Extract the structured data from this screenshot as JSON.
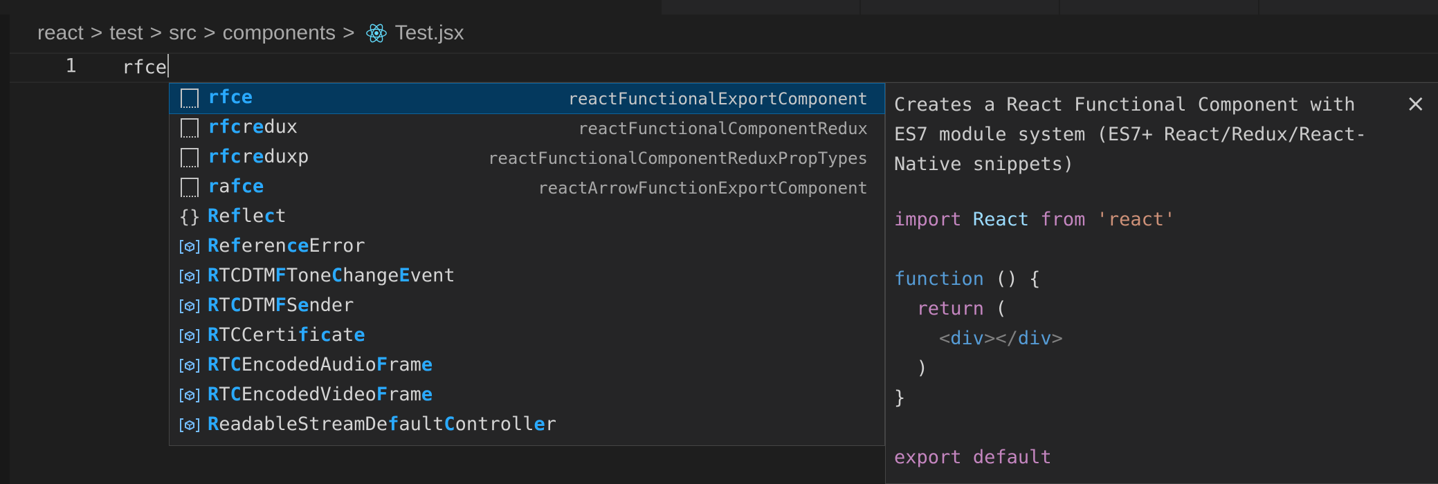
{
  "breadcrumb": {
    "items": [
      "react",
      "test",
      "src",
      "components"
    ],
    "file": "Test.jsx",
    "separator": ">"
  },
  "editor": {
    "line_number": "1",
    "content": "rfce"
  },
  "suggestions": [
    {
      "icon": "snippet-icon",
      "parts": [
        {
          "t": "rfce",
          "m": true
        }
      ],
      "detail": "reactFunctionalExportComponent",
      "selected": true
    },
    {
      "icon": "snippet-icon",
      "parts": [
        {
          "t": "rfc",
          "m": true
        },
        {
          "t": "r",
          "m": false
        },
        {
          "t": "e",
          "m": true
        },
        {
          "t": "dux",
          "m": false
        }
      ],
      "detail": "reactFunctionalComponentRedux"
    },
    {
      "icon": "snippet-icon",
      "parts": [
        {
          "t": "rfc",
          "m": true
        },
        {
          "t": "r",
          "m": false
        },
        {
          "t": "e",
          "m": true
        },
        {
          "t": "duxp",
          "m": false
        }
      ],
      "detail": "reactFunctionalComponentReduxPropTypes"
    },
    {
      "icon": "snippet-icon",
      "parts": [
        {
          "t": "r",
          "m": true
        },
        {
          "t": "a",
          "m": false
        },
        {
          "t": "fce",
          "m": true
        }
      ],
      "detail": "reactArrowFunctionExportComponent"
    },
    {
      "icon": "module-icon",
      "parts": [
        {
          "t": "R",
          "m": true
        },
        {
          "t": "e",
          "m": false
        },
        {
          "t": "f",
          "m": true
        },
        {
          "t": "le",
          "m": false
        },
        {
          "t": "c",
          "m": true
        },
        {
          "t": "t",
          "m": false
        }
      ],
      "detail": ""
    },
    {
      "icon": "class-icon",
      "parts": [
        {
          "t": "R",
          "m": true
        },
        {
          "t": "e",
          "m": false
        },
        {
          "t": "f",
          "m": true
        },
        {
          "t": "eren",
          "m": false
        },
        {
          "t": "ce",
          "m": true
        },
        {
          "t": "Error",
          "m": false
        }
      ],
      "detail": ""
    },
    {
      "icon": "class-icon",
      "parts": [
        {
          "t": "R",
          "m": true
        },
        {
          "t": "TCDTM",
          "m": false
        },
        {
          "t": "F",
          "m": true
        },
        {
          "t": "Tone",
          "m": false
        },
        {
          "t": "C",
          "m": true
        },
        {
          "t": "hange",
          "m": false
        },
        {
          "t": "E",
          "m": true
        },
        {
          "t": "vent",
          "m": false
        }
      ],
      "detail": ""
    },
    {
      "icon": "class-icon",
      "parts": [
        {
          "t": "R",
          "m": true
        },
        {
          "t": "T",
          "m": false
        },
        {
          "t": "C",
          "m": true
        },
        {
          "t": "DTM",
          "m": false
        },
        {
          "t": "F",
          "m": true
        },
        {
          "t": "S",
          "m": false
        },
        {
          "t": "e",
          "m": true
        },
        {
          "t": "nder",
          "m": false
        }
      ],
      "detail": ""
    },
    {
      "icon": "class-icon",
      "parts": [
        {
          "t": "R",
          "m": true
        },
        {
          "t": "TCCerti",
          "m": false
        },
        {
          "t": "f",
          "m": true
        },
        {
          "t": "i",
          "m": false
        },
        {
          "t": "c",
          "m": true
        },
        {
          "t": "at",
          "m": false
        },
        {
          "t": "e",
          "m": true
        }
      ],
      "detail": ""
    },
    {
      "icon": "class-icon",
      "parts": [
        {
          "t": "R",
          "m": true
        },
        {
          "t": "T",
          "m": false
        },
        {
          "t": "C",
          "m": true
        },
        {
          "t": "EncodedAudio",
          "m": false
        },
        {
          "t": "F",
          "m": true
        },
        {
          "t": "ram",
          "m": false
        },
        {
          "t": "e",
          "m": true
        }
      ],
      "detail": ""
    },
    {
      "icon": "class-icon",
      "parts": [
        {
          "t": "R",
          "m": true
        },
        {
          "t": "T",
          "m": false
        },
        {
          "t": "C",
          "m": true
        },
        {
          "t": "EncodedVideo",
          "m": false
        },
        {
          "t": "F",
          "m": true
        },
        {
          "t": "ram",
          "m": false
        },
        {
          "t": "e",
          "m": true
        }
      ],
      "detail": ""
    },
    {
      "icon": "class-icon",
      "parts": [
        {
          "t": "R",
          "m": true
        },
        {
          "t": "eadableStreamDe",
          "m": false
        },
        {
          "t": "f",
          "m": true
        },
        {
          "t": "ault",
          "m": false
        },
        {
          "t": "C",
          "m": true
        },
        {
          "t": "ontroll",
          "m": false
        },
        {
          "t": "e",
          "m": true
        },
        {
          "t": "r",
          "m": false
        }
      ],
      "detail": ""
    }
  ],
  "docs": {
    "close": "×",
    "description": "Creates a React Functional Component with ES7 module system (ES7+ React/Redux/React-Native snippets)",
    "code": {
      "import_kw": "import",
      "react_name": "React",
      "from_kw": "from",
      "react_str": "'react'",
      "function_kw": "function",
      "fn_sig": " () {",
      "return_kw": "return",
      "paren_open": " (",
      "tag_open_lt": "<",
      "div": "div",
      "tag_mid": "></",
      "tag_close_gt": ">",
      "paren_close": ")",
      "brace_close": "}",
      "export_kw": "export",
      "default_kw": "default"
    }
  },
  "colors": {
    "background": "#1e1e1e",
    "match_highlight": "#2aaaff",
    "selected_row": "#04395e"
  }
}
